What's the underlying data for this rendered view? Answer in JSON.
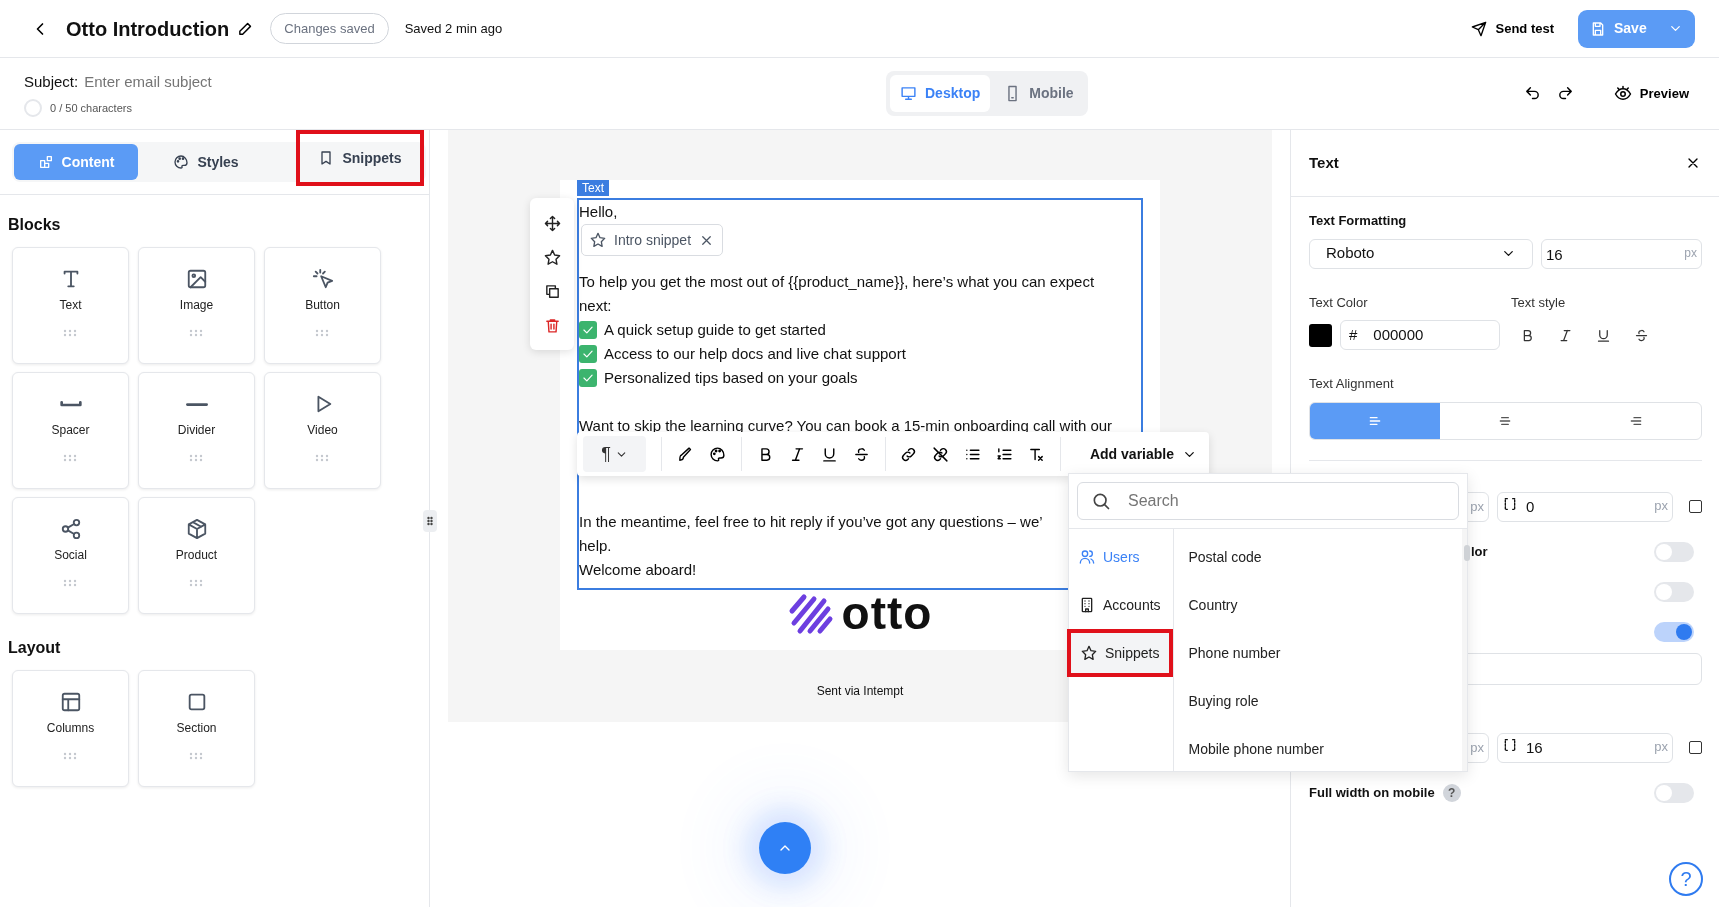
{
  "header": {
    "title": "Otto Introduction",
    "status_badge": "Changes saved",
    "saved_text": "Saved 2 min ago",
    "send_test": "Send test",
    "save": "Save"
  },
  "subject": {
    "label": "Subject:",
    "placeholder": "Enter email subject",
    "counter": "0 / 50 characters"
  },
  "view_toggle": [
    {
      "label": "Desktop",
      "kind": "desktop",
      "selected": true
    },
    {
      "label": "Mobile",
      "kind": "mobile",
      "selected": false
    }
  ],
  "preview": "Preview",
  "left_tabs": [
    {
      "label": "Content",
      "kind": "content",
      "selected": true,
      "highlighted": false
    },
    {
      "label": "Styles",
      "kind": "styles",
      "selected": false,
      "highlighted": false
    },
    {
      "label": "Snippets",
      "kind": "snippets",
      "selected": false,
      "highlighted": true
    }
  ],
  "block_groups": [
    {
      "title": "Blocks",
      "items": [
        {
          "label": "Text",
          "kind": "text"
        },
        {
          "label": "Image",
          "kind": "image"
        },
        {
          "label": "Button",
          "kind": "button"
        },
        {
          "label": "Spacer",
          "kind": "spacer"
        },
        {
          "label": "Divider",
          "kind": "divider"
        },
        {
          "label": "Video",
          "kind": "video"
        },
        {
          "label": "Social",
          "kind": "social"
        },
        {
          "label": "Product",
          "kind": "product"
        }
      ]
    },
    {
      "title": "Layout",
      "items": [
        {
          "label": "Columns",
          "kind": "columns"
        },
        {
          "label": "Section",
          "kind": "section"
        }
      ]
    }
  ],
  "email": {
    "block_tag": "Text",
    "greeting": "Hello,",
    "snippet_chip": "Intro snippet",
    "intro": "To help you get the most out of {{product_name}}, here’s what you can expect next:",
    "checklist": [
      {
        "text": "A quick setup guide to get started",
        "checked": true
      },
      {
        "text": "Access to our help docs and live chat support",
        "checked": true
      },
      {
        "text": "Personalized tips based on your goals",
        "checked": true
      }
    ],
    "covered_line": "Want to skip the learning curve? You can book a 15-min onboarding call with our",
    "closing_lines": [
      "In the meantime, feel free to hit reply if you’ve got any questions – we’",
      "help.",
      "Welcome aboard!"
    ],
    "logo_text": "otto",
    "footer": "Sent via Intempt"
  },
  "toolbar": {
    "paragraph_symbol": "¶",
    "add_variable": "Add variable"
  },
  "variable_menu": {
    "search_placeholder": "Search",
    "categories": [
      {
        "label": "Users",
        "kind": "users",
        "selected": true,
        "hovered": false,
        "highlighted": false
      },
      {
        "label": "Accounts",
        "kind": "accounts",
        "selected": false,
        "hovered": false,
        "highlighted": false
      },
      {
        "label": "Snippets",
        "kind": "snippets",
        "selected": false,
        "hovered": true,
        "highlighted": true
      }
    ],
    "items": [
      "Postal code",
      "Country",
      "Phone number",
      "Buying role",
      "Mobile phone number"
    ]
  },
  "properties": {
    "title": "Text",
    "formatting_label": "Text Formatting",
    "font": "Roboto",
    "font_size": "16",
    "unit": "px",
    "color_label": "Text Color",
    "hash": "#",
    "color_value": "000000",
    "style_label": "Text style",
    "style_buttons": [
      {
        "kind": "bold"
      },
      {
        "kind": "italic"
      },
      {
        "kind": "underline"
      },
      {
        "kind": "strike"
      }
    ],
    "alignment_label": "Text Alignment",
    "alignments": [
      {
        "kind": "left",
        "selected": true
      },
      {
        "kind": "center",
        "selected": false
      },
      {
        "kind": "right",
        "selected": false
      }
    ],
    "field_rows": [
      {
        "side_unit": "px",
        "value": "0",
        "unit": "px",
        "checked": false
      },
      {
        "side_unit": "px",
        "value": "16",
        "unit": "px",
        "checked": false
      }
    ],
    "toggle_rows": [
      {
        "label": "lor",
        "on": false
      },
      {
        "on": false
      },
      {
        "on": true
      }
    ],
    "full_width_label": "Full width on mobile",
    "full_width_help": "?",
    "full_width_on": false
  },
  "help_button": "?"
}
